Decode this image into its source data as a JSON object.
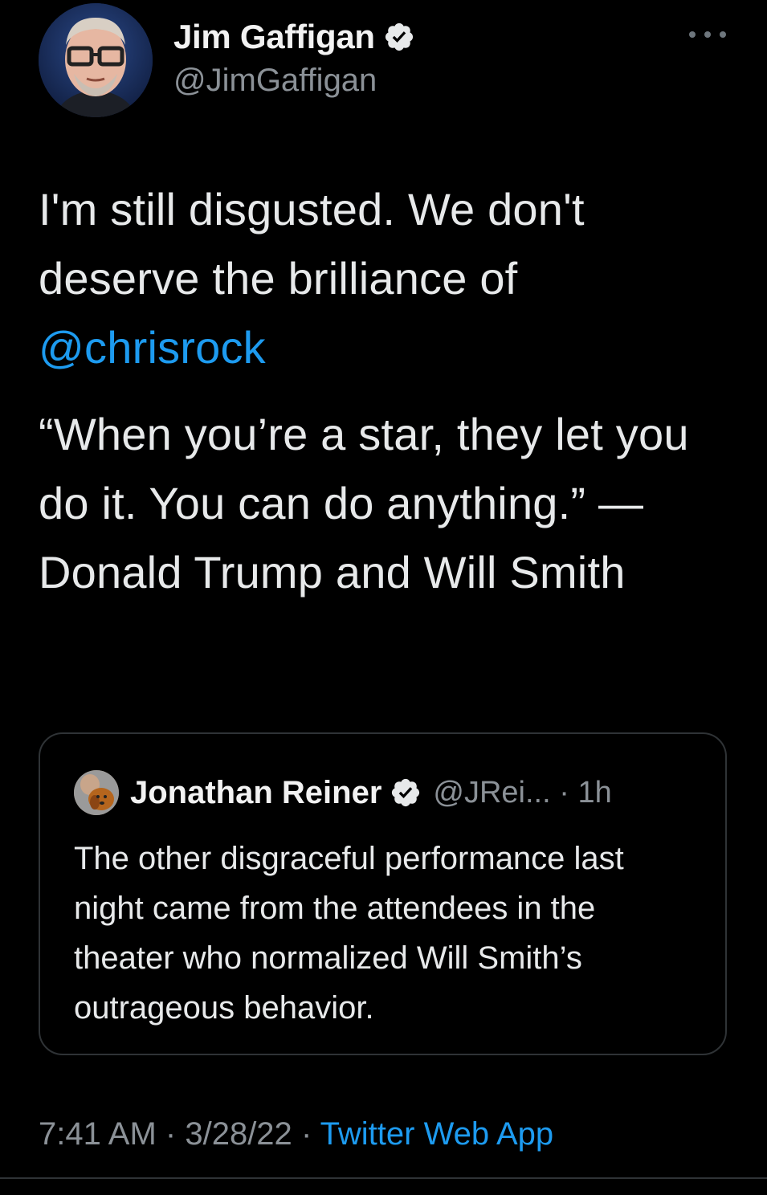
{
  "author": {
    "display_name": "Jim Gaffigan",
    "handle": "@JimGaffigan",
    "verified": true
  },
  "tweet": {
    "paragraph1_text": "I'm still disgusted.  We don't deserve the brilliance of ",
    "mention": "@chrisrock",
    "paragraph2_text": "“When you’re a star, they let you do it. You can do anything.” —Donald Trump and Will Smith"
  },
  "quoted_tweet": {
    "display_name": "Jonathan Reiner",
    "verified": true,
    "handle_truncated": "@JRei...",
    "separator": "·",
    "time_ago": "1h",
    "text": "The other disgraceful performance last night came from the attendees in the theater who normalized Will Smith’s outrageous behavior."
  },
  "footer": {
    "time": "7:41 AM",
    "separator": "·",
    "date": "3/28/22",
    "source": "Twitter Web App"
  },
  "icons": {
    "more": "more-horizontal-icon",
    "verified": "verified-badge-icon"
  },
  "colors": {
    "background": "#000000",
    "text": "#e7e9ea",
    "secondary_text": "#8b9197",
    "link": "#1d9bf0",
    "border": "#2f3336"
  }
}
